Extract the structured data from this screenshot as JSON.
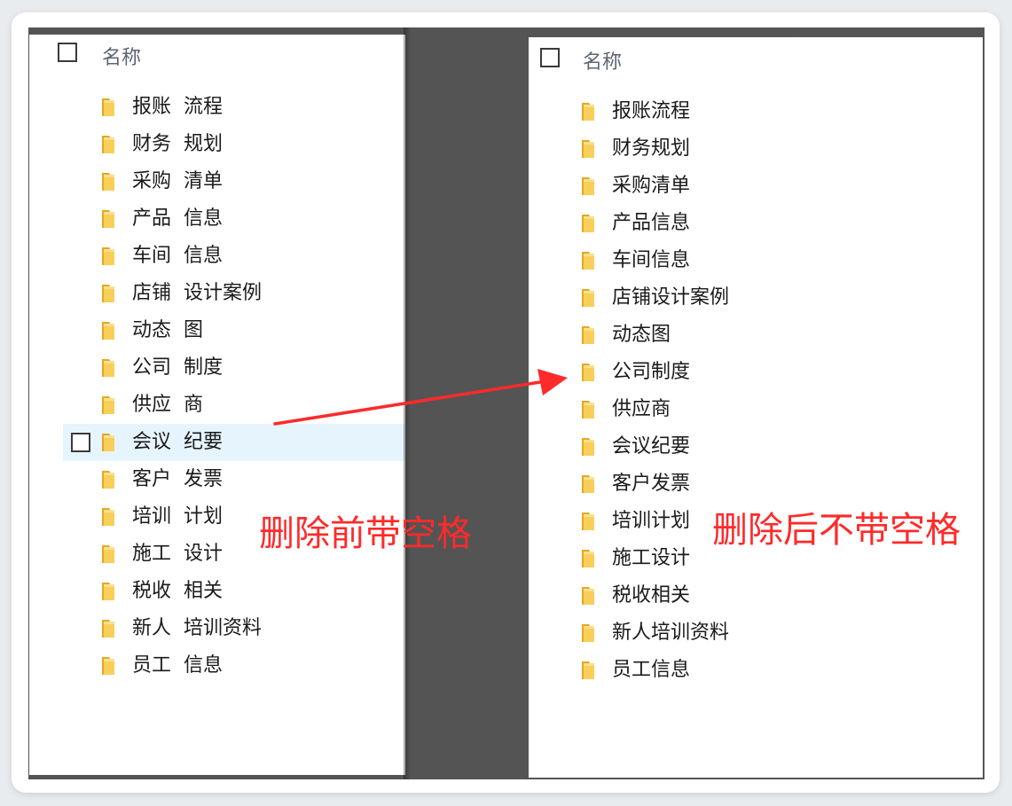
{
  "header": {
    "name_label": "名称"
  },
  "before_list": [
    "报账  流程",
    "财务  规划",
    "采购  清单",
    "产品  信息",
    "车间  信息",
    "店铺  设计案例",
    "动态  图",
    "公司  制度",
    "供应  商",
    "会议  纪要",
    "客户  发票",
    "培训  计划",
    "施工  设计",
    "税收  相关",
    "新人  培训资料",
    "员工  信息"
  ],
  "after_list": [
    "报账流程",
    "财务规划",
    "采购清单",
    "产品信息",
    "车间信息",
    "店铺设计案例",
    "动态图",
    "公司制度",
    "供应商",
    "会议纪要",
    "客户发票",
    "培训计划",
    "施工设计",
    "税收相关",
    "新人培训资料",
    "员工信息"
  ],
  "annotations": {
    "before": "删除前带空格",
    "after": "删除后不带空格"
  },
  "highlight_index": 9,
  "colors": {
    "annotation": "#ff2a2a",
    "highlight_row": "#e6f4fd",
    "divider": "#545454",
    "folder": "#f5c542"
  },
  "icons": [
    "folder-icon",
    "checkbox",
    "arrow",
    "close-icon"
  ]
}
